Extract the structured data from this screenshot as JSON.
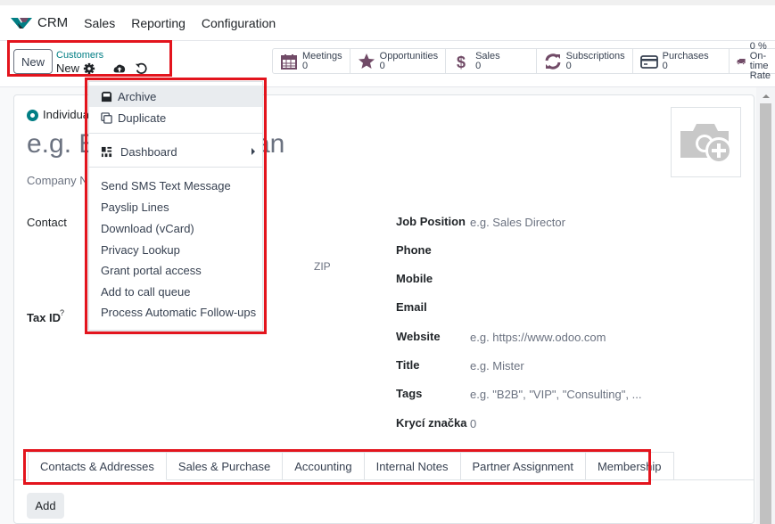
{
  "navbar": {
    "app_name": "CRM",
    "menu": [
      "Sales",
      "Reporting",
      "Configuration"
    ],
    "brand_color": "#714b67"
  },
  "control_panel": {
    "new_label": "New",
    "breadcrumb_parent": "Customers",
    "breadcrumb_current": "New",
    "icons": [
      "gear-icon",
      "cloud-upload-icon",
      "discard-icon"
    ]
  },
  "smart_buttons": [
    {
      "icon": "calendar-icon",
      "label": "Meetings",
      "value": "0"
    },
    {
      "icon": "star-icon",
      "label": "Opportunities",
      "value": "0"
    },
    {
      "icon": "dollar-icon",
      "label": "Sales",
      "value": "0"
    },
    {
      "icon": "refresh-icon",
      "label": "Subscriptions",
      "value": "0"
    },
    {
      "icon": "credit-card-icon",
      "label": "Purchases",
      "value": "0"
    },
    {
      "icon": "truck-icon",
      "label": "On-time Rate",
      "value": "0 %"
    }
  ],
  "action_menu": {
    "items": [
      {
        "label": "Archive",
        "icon": "archive-icon",
        "active": true
      },
      {
        "label": "Duplicate",
        "icon": "duplicate-icon"
      },
      {
        "label": "Dashboard",
        "icon": "dashboard-icon",
        "submenu": true
      },
      {
        "label": "Send SMS Text Message"
      },
      {
        "label": "Payslip Lines"
      },
      {
        "label": "Download (vCard)"
      },
      {
        "label": "Privacy Lookup"
      },
      {
        "label": "Grant portal access"
      },
      {
        "label": "Add to call queue"
      },
      {
        "label": "Process Automatic Follow-ups"
      }
    ]
  },
  "form": {
    "type_radio_label": "Individual",
    "name_placeholder": "e.g. Brandon Freeman",
    "name_visible_start": "e.g. B",
    "name_visible_end": "an",
    "company_placeholder": "Company Name...",
    "company_visible": "Company N",
    "contact_label": "Contact",
    "zip_placeholder": "ZIP",
    "tax_id_label": "Tax ID",
    "tax_id_help": "?",
    "right_fields": [
      {
        "label": "Job Position",
        "value": "e.g. Sales Director"
      },
      {
        "label": "Phone",
        "value": ""
      },
      {
        "label": "Mobile",
        "value": ""
      },
      {
        "label": "Email",
        "value": ""
      },
      {
        "label": "Website",
        "value": "e.g. https://www.odoo.com"
      },
      {
        "label": "Title",
        "value": "e.g. Mister"
      },
      {
        "label": "Tags",
        "value": "e.g. \"B2B\", \"VIP\", \"Consulting\", ..."
      },
      {
        "label": "Krycí značka",
        "value": "0"
      }
    ]
  },
  "tabs": [
    "Contacts & Addresses",
    "Sales & Purchase",
    "Accounting",
    "Internal Notes",
    "Partner Assignment",
    "Membership"
  ],
  "add_label": "Add",
  "highlight_color": "#e3141d",
  "accent_color": "#017e84"
}
